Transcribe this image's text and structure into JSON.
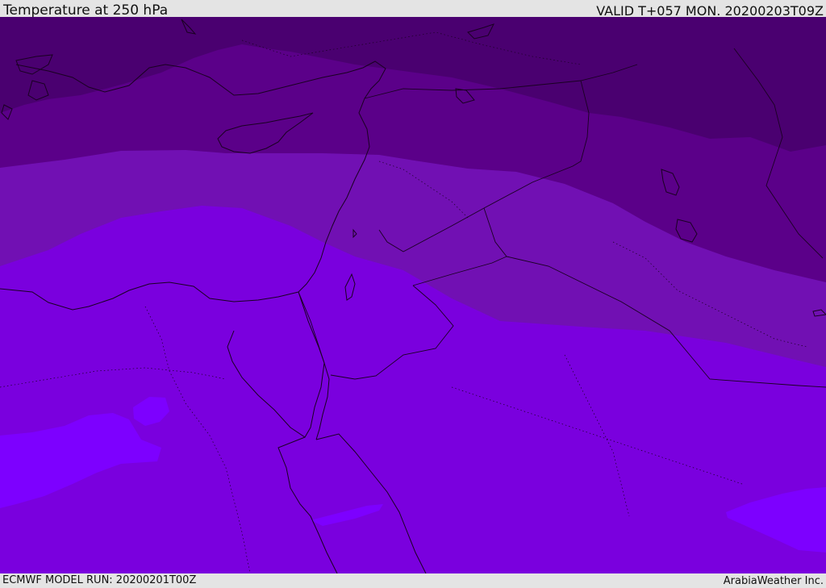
{
  "header": {
    "title": "Temperature at 250 hPa",
    "valid_time": "VALID T+057 MON. 20200203T09Z"
  },
  "footer": {
    "model_run": "ECMWF MODEL RUN: 20200201T00Z",
    "credit": "ArabiaWeather Inc."
  },
  "map": {
    "region": "Eastern Mediterranean / Levant",
    "colors": {
      "band_darkest": "#4a0070",
      "band_dark": "#5b0089",
      "band_medium": "#7110b3",
      "band_light": "#7a00de",
      "band_lightest": "#7d00ff",
      "coastline": "#1a0022"
    }
  }
}
